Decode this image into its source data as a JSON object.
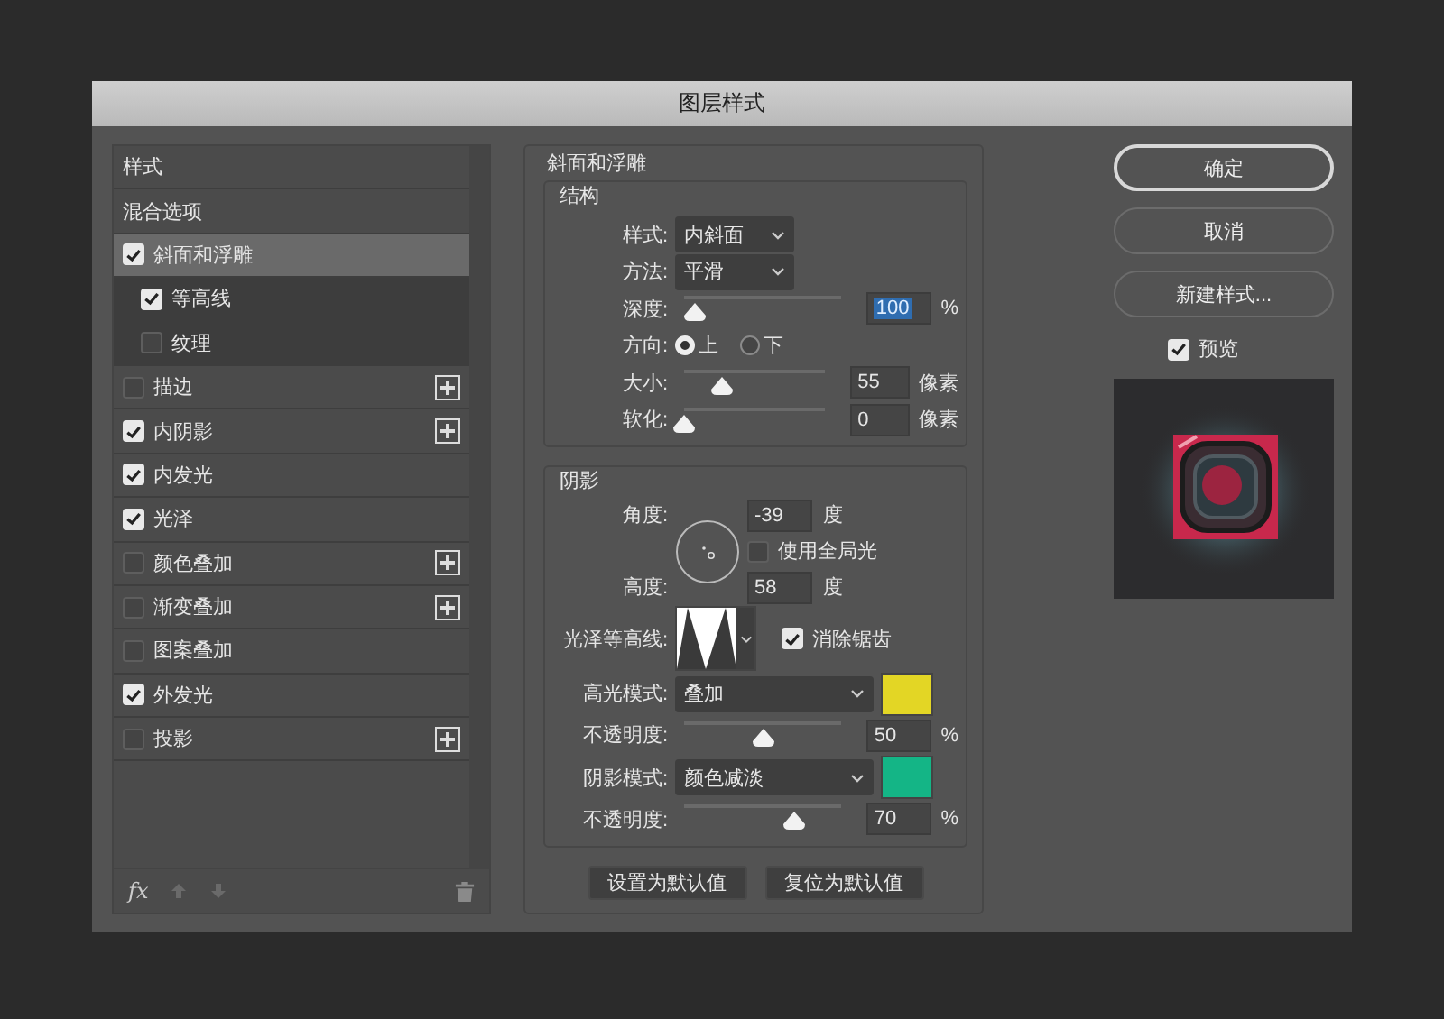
{
  "window": {
    "title": "图层样式"
  },
  "styles_list": {
    "items": [
      {
        "label": "样式",
        "kind": "header",
        "selected": false
      },
      {
        "label": "混合选项",
        "kind": "header",
        "selected": false
      },
      {
        "label": "斜面和浮雕",
        "kind": "effect",
        "checked": true,
        "selected": true,
        "addable": false,
        "children": [
          {
            "label": "等高线",
            "kind": "effect",
            "checked": true,
            "selected": false
          },
          {
            "label": "纹理",
            "kind": "effect",
            "checked": false,
            "selected": false
          }
        ]
      },
      {
        "label": "描边",
        "kind": "effect",
        "checked": false,
        "selected": false,
        "addable": true
      },
      {
        "label": "内阴影",
        "kind": "effect",
        "checked": true,
        "selected": false,
        "addable": true
      },
      {
        "label": "内发光",
        "kind": "effect",
        "checked": true,
        "selected": false,
        "addable": false
      },
      {
        "label": "光泽",
        "kind": "effect",
        "checked": true,
        "selected": false,
        "addable": false
      },
      {
        "label": "颜色叠加",
        "kind": "effect",
        "checked": false,
        "selected": false,
        "addable": true
      },
      {
        "label": "渐变叠加",
        "kind": "effect",
        "checked": false,
        "selected": false,
        "addable": true
      },
      {
        "label": "图案叠加",
        "kind": "effect",
        "checked": false,
        "selected": false,
        "addable": false
      },
      {
        "label": "外发光",
        "kind": "effect",
        "checked": true,
        "selected": false,
        "addable": false
      },
      {
        "label": "投影",
        "kind": "effect",
        "checked": false,
        "selected": false,
        "addable": true
      }
    ],
    "footer": {
      "fx": "fx"
    }
  },
  "panel": {
    "title": "斜面和浮雕",
    "structure": {
      "title": "结构",
      "rows": [
        {
          "kind": "select",
          "label": "样式:",
          "value": "内斜面"
        },
        {
          "kind": "select",
          "label": "方法:",
          "value": "平滑"
        },
        {
          "kind": "slider",
          "label": "深度:",
          "level": 0.07,
          "value": "100",
          "unit": "%",
          "focused": true
        },
        {
          "kind": "radio",
          "label": "方向:",
          "options": [
            {
              "label": "上",
              "selected": true
            },
            {
              "label": "下",
              "selected": false
            }
          ]
        },
        {
          "kind": "slider",
          "label": "大小:",
          "level": 0.27,
          "value": "55",
          "unit": "像素",
          "focused": false
        },
        {
          "kind": "slider",
          "label": "软化:",
          "level": 0,
          "value": "0",
          "unit": "像素",
          "focused": false
        }
      ]
    },
    "shading": {
      "title": "阴影",
      "angle": {
        "label": "角度:",
        "value": "-39",
        "unit": "度"
      },
      "global_light": {
        "label": "使用全局光",
        "checked": false
      },
      "altitude": {
        "label": "高度:",
        "value": "58",
        "unit": "度"
      },
      "gloss_contour": {
        "label": "光泽等高线:"
      },
      "anti_alias": {
        "label": "消除锯齿",
        "checked": true
      },
      "rows": [
        {
          "kind": "mode",
          "label": "高光模式:",
          "value": "叠加",
          "color": "#e3d625"
        },
        {
          "kind": "slider",
          "label": "不透明度:",
          "level": 0.5,
          "value": "50",
          "unit": "%",
          "focused": false
        },
        {
          "kind": "mode",
          "label": "阴影模式:",
          "value": "颜色减淡",
          "color": "#14b586"
        },
        {
          "kind": "slider",
          "label": "不透明度:",
          "level": 0.7,
          "value": "70",
          "unit": "%",
          "focused": false
        }
      ]
    },
    "buttons": [
      {
        "label": "设置为默认值"
      },
      {
        "label": "复位为默认值"
      }
    ]
  },
  "actions": {
    "buttons": [
      {
        "label": "确定",
        "default": true
      },
      {
        "label": "取消",
        "default": false
      },
      {
        "label": "新建样式...",
        "default": false
      }
    ],
    "preview": {
      "label": "预览",
      "checked": true
    }
  }
}
